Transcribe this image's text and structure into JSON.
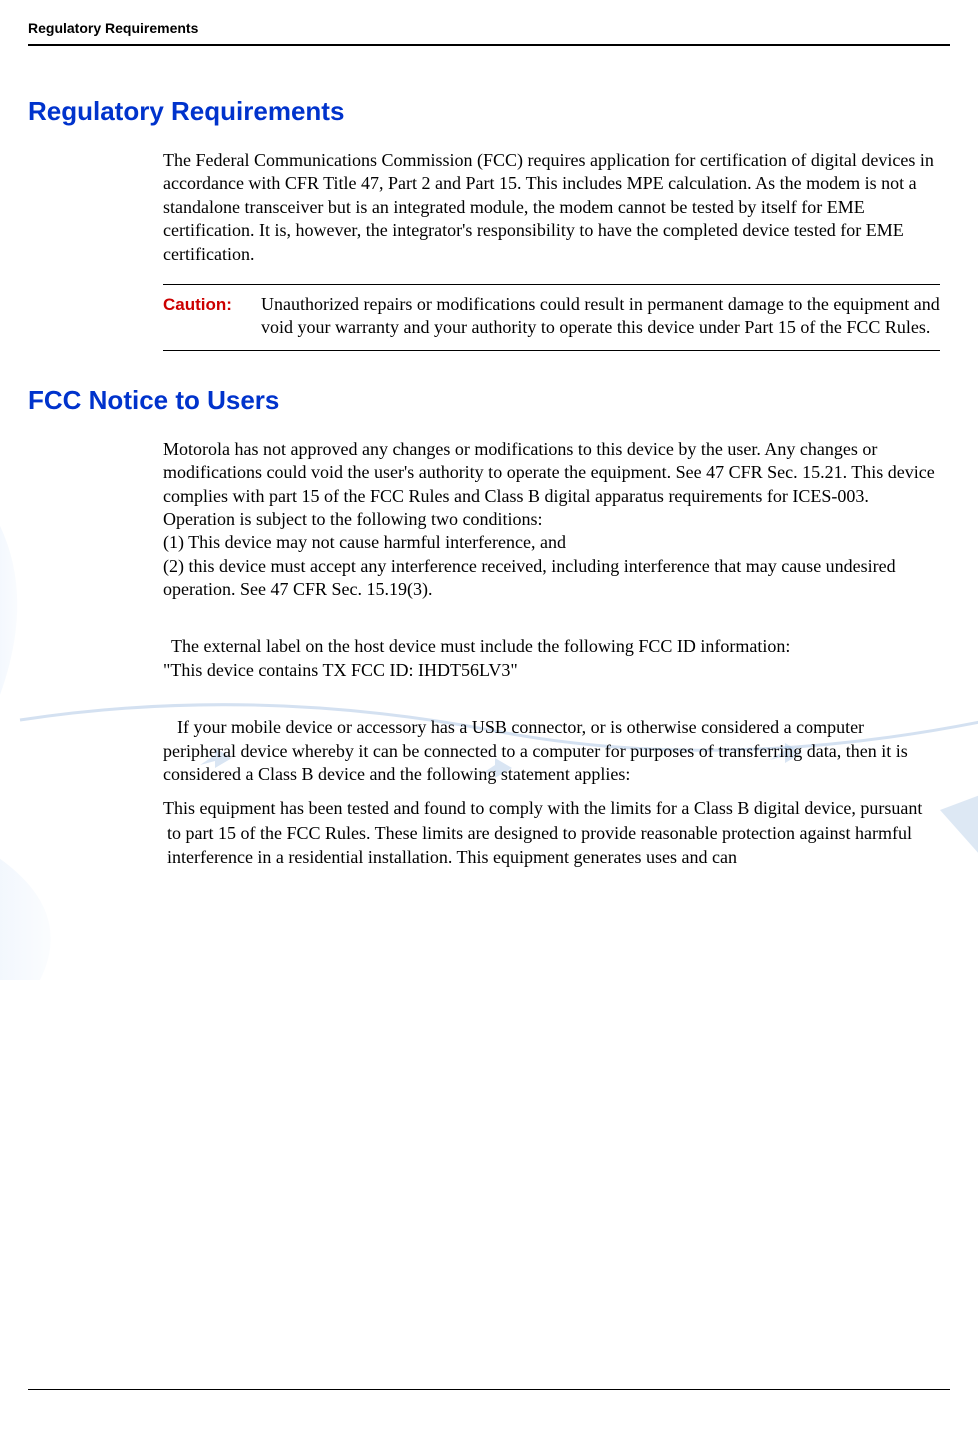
{
  "page_header": "Regulatory Requirements",
  "section1": {
    "title": "Regulatory Requirements",
    "body": "The Federal Communications Commission (FCC) requires application for certification of digital devices in accordance with CFR Title 47, Part 2 and Part 15. This includes MPE calculation. As the  modem is not a standalone transceiver but is an integrated module, the modem cannot be tested by itself for EME certification. It is, however, the integrator's responsibility to have the completed device tested for EME certification."
  },
  "caution": {
    "label": "Caution:",
    "text": "Unauthorized repairs or modifications could result in permanent damage to the equipment and void your warranty and your authority to operate this device under Part 15 of the FCC Rules."
  },
  "section2": {
    "title": "FCC Notice to Users",
    "para1": "Motorola has not approved any changes or modifications to this device by the user. Any changes or modifications could void the user's authority to operate the equipment. See 47 CFR Sec. 15.21. This device complies with part 15 of the FCC Rules and Class B digital apparatus requirements for ICES-003. Operation is subject to the following two conditions:",
    "cond1": "(1) This device may not cause harmful interference, and",
    "cond2": "(2) this device must accept any interference received, including interference that may cause undesired operation. See 47 CFR Sec. 15.19(3).",
    "label_line1": "The external label on the host device must include the following FCC ID information:",
    "label_line2": "\"This device contains TX FCC ID: IHDT56LV3\"",
    "usb": "If your mobile device or accessory has a USB connector, or is otherwise considered a computer peripheral device whereby it can be connected to a computer for purposes of transferring data, then it is considered a Class B device and the following statement applies:",
    "compliance": "This equipment has been tested and found to comply with the limits for a Class B digital device, pursuant to part 15 of the FCC Rules. These limits are designed to provide reasonable protection against harmful interference in a residential installation. This equipment generates uses and can"
  }
}
